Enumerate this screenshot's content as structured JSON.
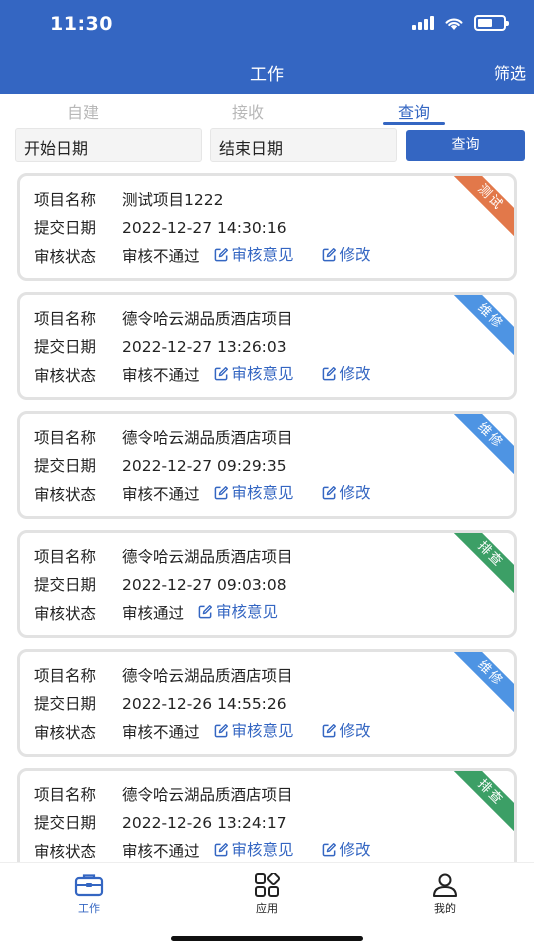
{
  "status_bar": {
    "time": "11:30"
  },
  "header": {
    "title": "工作",
    "filter_label": "筛选"
  },
  "tabs": [
    {
      "label": "自建"
    },
    {
      "label": "接收"
    },
    {
      "label": "查询"
    }
  ],
  "search": {
    "start_date": "开始日期",
    "end_date": "结束日期",
    "query_label": "查询"
  },
  "labels": {
    "project_name": "项目名称",
    "submit_date": "提交日期",
    "review_status": "审核状态",
    "review_opinion": "审核意见",
    "modify": "修改"
  },
  "records": [
    {
      "name": "测试项目1222",
      "date": "2022-12-27 14:30:16",
      "status": "审核不通过",
      "tag": "测试",
      "tag_color": "#e2784a",
      "can_modify": true
    },
    {
      "name": "德令哈云湖品质酒店项目",
      "date": "2022-12-27 13:26:03",
      "status": "审核不通过",
      "tag": "维修",
      "tag_color": "#4e94e3",
      "can_modify": true
    },
    {
      "name": "德令哈云湖品质酒店项目",
      "date": "2022-12-27 09:29:35",
      "status": "审核不通过",
      "tag": "维修",
      "tag_color": "#4e94e3",
      "can_modify": true
    },
    {
      "name": "德令哈云湖品质酒店项目",
      "date": "2022-12-27 09:03:08",
      "status": "审核通过",
      "tag": "排查",
      "tag_color": "#3c9f66",
      "can_modify": false
    },
    {
      "name": "德令哈云湖品质酒店项目",
      "date": "2022-12-26 14:55:26",
      "status": "审核不通过",
      "tag": "维修",
      "tag_color": "#4e94e3",
      "can_modify": true
    },
    {
      "name": "德令哈云湖品质酒店项目",
      "date": "2022-12-26 13:24:17",
      "status": "审核不通过",
      "tag": "排查",
      "tag_color": "#3c9f66",
      "can_modify": true
    }
  ],
  "tabbar": [
    {
      "label": "工作",
      "icon": "briefcase-icon"
    },
    {
      "label": "应用",
      "icon": "apps-grid-icon"
    },
    {
      "label": "我的",
      "icon": "user-icon"
    }
  ],
  "colors": {
    "primary": "#3466c2"
  }
}
